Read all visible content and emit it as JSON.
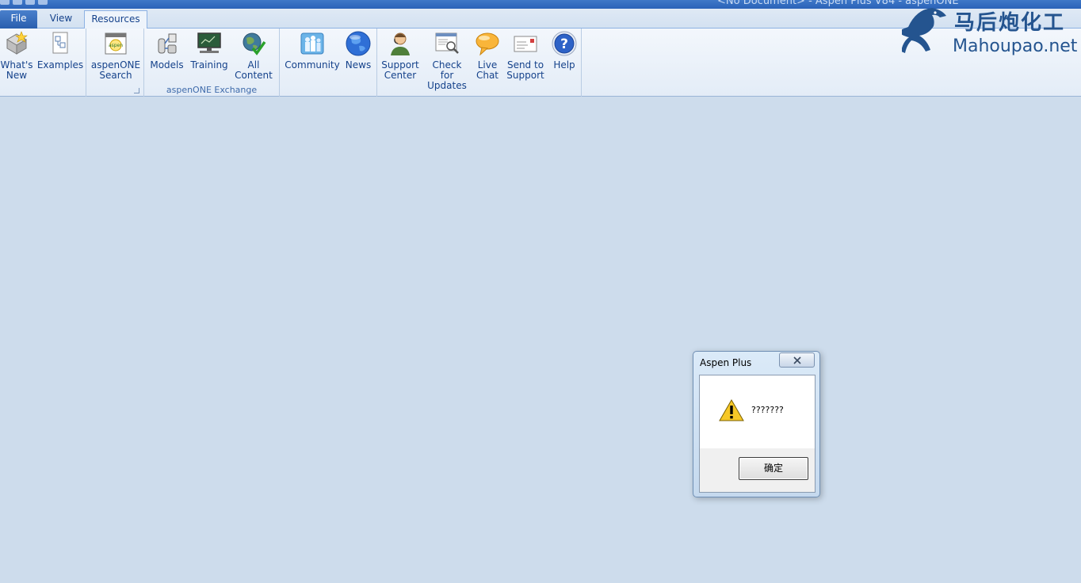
{
  "window": {
    "title": "<No Document> - Aspen Plus V84 - aspenONE"
  },
  "tabs": [
    "File",
    "View",
    "Resources"
  ],
  "ribbon": {
    "buttons": {
      "whats_new": "What's\nNew",
      "examples": "Examples",
      "aspenone_search": "aspenONE\nSearch",
      "models": "Models",
      "training": "Training",
      "all_content": "All\nContent",
      "community": "Community",
      "news": "News",
      "support_center": "Support\nCenter",
      "check_for_updates": "Check for\nUpdates",
      "live_chat": "Live\nChat",
      "send_to_support": "Send to\nSupport",
      "help": "Help"
    },
    "group_captions": {
      "exchange": "aspenONE Exchange"
    }
  },
  "watermark": {
    "chinese": "马后炮化工",
    "site": "Mahoupao.net"
  },
  "dialog": {
    "title": "Aspen Plus",
    "message": "???????",
    "ok_label": "确定"
  },
  "icons": [
    "whats-new-icon",
    "examples-icon",
    "aspenone-search-icon",
    "models-icon",
    "training-icon",
    "all-content-icon",
    "community-icon",
    "news-icon",
    "support-center-icon",
    "check-for-updates-icon",
    "live-chat-icon",
    "send-to-support-icon",
    "help-icon",
    "warning-icon",
    "close-icon"
  ],
  "colors": {
    "accent": "#2a62b8",
    "workspace": "#cddcec",
    "label": "#15428b"
  }
}
